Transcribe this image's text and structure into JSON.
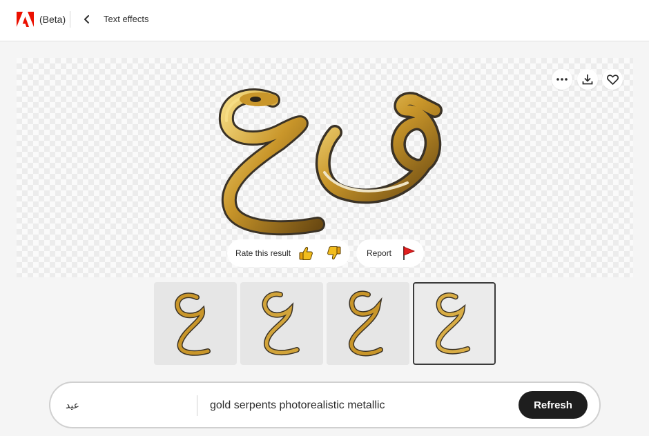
{
  "header": {
    "beta_label": "(Beta)",
    "page_title": "Text effects",
    "brand_color": "#eb1000"
  },
  "preview": {
    "actions": [
      "more-icon",
      "download-icon",
      "heart-icon"
    ],
    "rate_label": "Rate this result",
    "report_label": "Report",
    "art_colors": {
      "gold": "#c9962a",
      "dark": "#3a3226",
      "highlight": "#f6dd84"
    }
  },
  "variations": {
    "count": 4,
    "selected_index": 3
  },
  "prompt": {
    "text_value": "عيد",
    "effect_prompt": "gold serpents photorealistic metallic",
    "refresh_label": "Refresh"
  }
}
